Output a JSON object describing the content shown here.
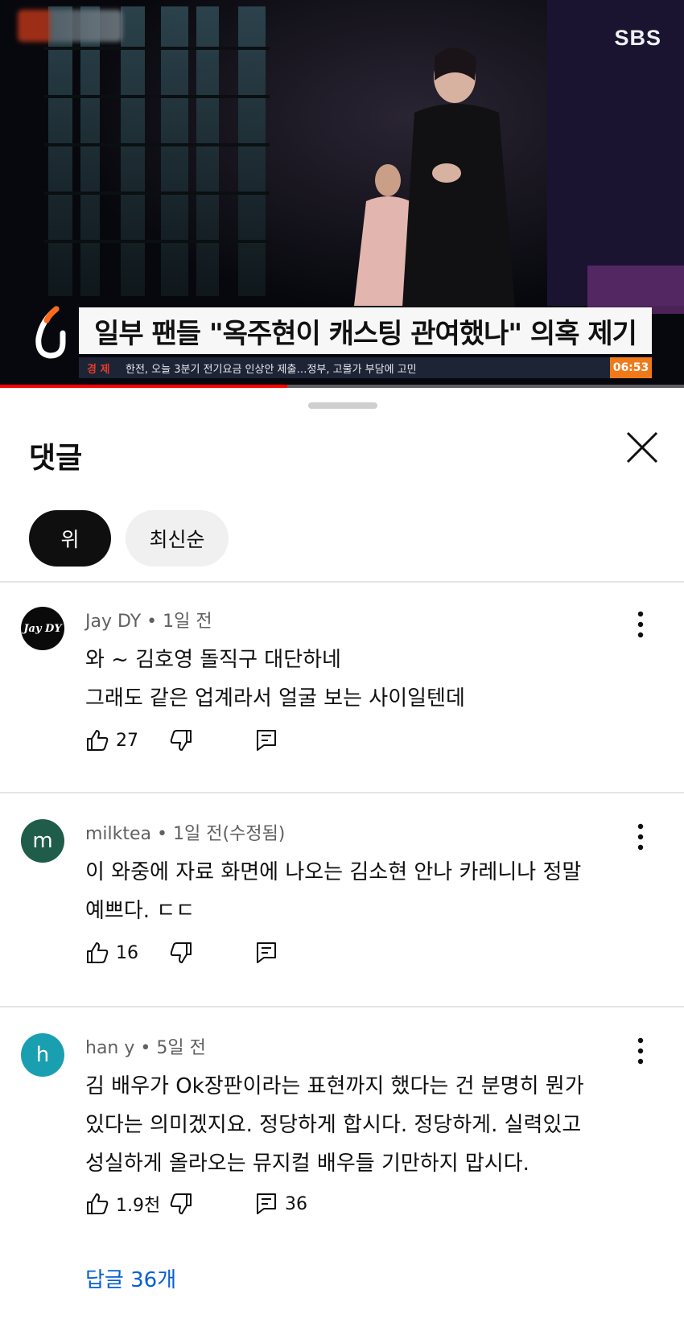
{
  "video": {
    "channel_logo": "SBS",
    "headline": "일부 팬들 \"옥주현이 캐스팅 관여했나\" 의혹 제기",
    "ticker_category": "경 제",
    "ticker_text": "한전, 오늘 3분기 전기요금 인상안 제출…정부, 고물가 부담에 고민",
    "ticker_time": "06:53",
    "progress": 0.42
  },
  "sheet": {
    "title": "댓글",
    "chips": [
      "위",
      "최신순"
    ]
  },
  "comments": [
    {
      "avatar_text": "Jay DY",
      "author": "Jay DY",
      "time": "1일 전",
      "lines": [
        "와 ~ 김호영 돌직구 대단하네",
        "그래도 같은 업계라서 얼굴 보는 사이일텐데"
      ],
      "likes": "27",
      "replies": ""
    },
    {
      "avatar_text": "m",
      "author": "milktea",
      "time": "1일 전(수정됨)",
      "lines": [
        "이 와중에 자료 화면에 나오는 김소현 안나 카레니나 정말",
        "예쁘다.  ㄷㄷ"
      ],
      "likes": "16",
      "replies": ""
    },
    {
      "avatar_text": "h",
      "author": "han y",
      "time": "5일 전",
      "lines": [
        "김 배우가 Ok장판이라는 표현까지 했다는 건 분명히 뭔가",
        "있다는 의미겠지요.  정당하게 합시다. 정당하게. 실력있고",
        "성실하게 올라오는 뮤지컬 배우들 기만하지 맙시다."
      ],
      "likes": "1.9천",
      "replies": "36",
      "replies_link": "답글 36개"
    }
  ],
  "icons": {
    "close": "close-icon",
    "more": "more-vert-icon",
    "like": "thumb-up-icon",
    "dislike": "thumb-down-icon",
    "reply": "comment-icon"
  }
}
